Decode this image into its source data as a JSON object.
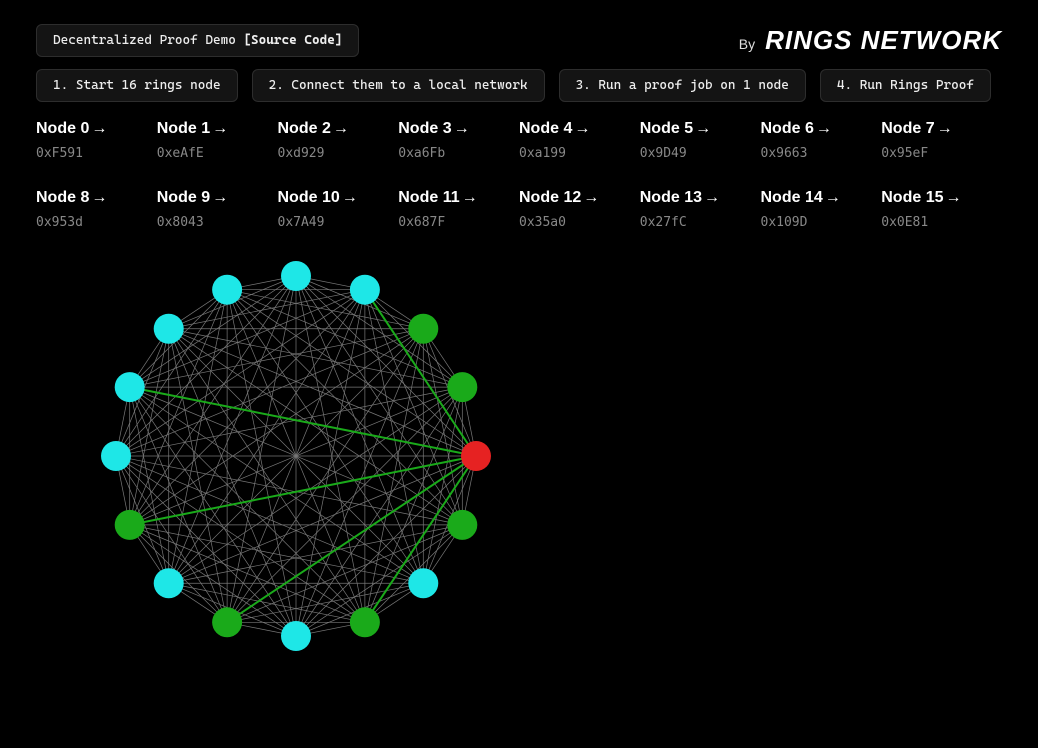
{
  "header": {
    "title_text": "Decentralized Proof Demo ",
    "title_link": "[Source Code]",
    "by": "By",
    "brand": "RINGS NETWORK"
  },
  "steps": [
    "1. Start 16 rings node",
    "2. Connect them to a local network",
    "3. Run a proof job on 1 node",
    "4. Run Rings Proof"
  ],
  "nodes": [
    {
      "label": "Node 0",
      "addr": "0xF591"
    },
    {
      "label": "Node 1",
      "addr": "0xeAfE"
    },
    {
      "label": "Node 2",
      "addr": "0xd929"
    },
    {
      "label": "Node 3",
      "addr": "0xa6Fb"
    },
    {
      "label": "Node 4",
      "addr": "0xa199"
    },
    {
      "label": "Node 5",
      "addr": "0x9D49"
    },
    {
      "label": "Node 6",
      "addr": "0x9663"
    },
    {
      "label": "Node 7",
      "addr": "0x95eF"
    },
    {
      "label": "Node 8",
      "addr": "0x953d"
    },
    {
      "label": "Node 9",
      "addr": "0x8043"
    },
    {
      "label": "Node 10",
      "addr": "0x7A49"
    },
    {
      "label": "Node 11",
      "addr": "0x687F"
    },
    {
      "label": "Node 12",
      "addr": "0x35a0"
    },
    {
      "label": "Node 13",
      "addr": "0x27fC"
    },
    {
      "label": "Node 14",
      "addr": "0x109D"
    },
    {
      "label": "Node 15",
      "addr": "0x0E81"
    }
  ],
  "graph": {
    "node_count": 16,
    "radius": 180,
    "node_r": 15,
    "colors": {
      "edge": "#777",
      "hl_edge": "#1aaa1a",
      "cyan": "#1ee7e7",
      "green": "#1aaa1a",
      "red": "#e62222"
    },
    "node_styles": [
      "red",
      "green",
      "cyan",
      "green",
      "cyan",
      "green",
      "cyan",
      "green",
      "cyan",
      "cyan",
      "cyan",
      "cyan",
      "cyan",
      "cyan",
      "green",
      "green"
    ],
    "highlight_from": 0,
    "highlight_to": [
      3,
      5,
      7,
      9,
      13
    ]
  }
}
